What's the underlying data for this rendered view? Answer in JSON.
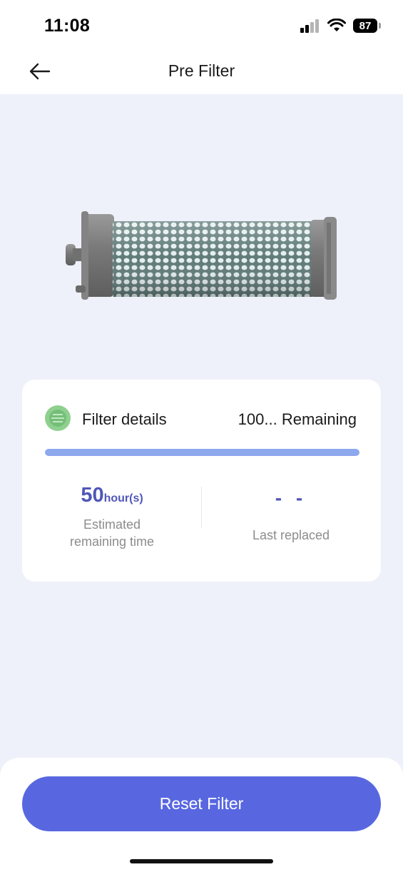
{
  "status": {
    "time": "11:08",
    "battery": "87"
  },
  "nav": {
    "title": "Pre Filter",
    "back_icon": "arrow-left-icon"
  },
  "card": {
    "title": "Filter details",
    "remaining": "100... Remaining",
    "progress_percent": 100,
    "estimated": {
      "value": "50",
      "unit": "hour(s)",
      "label_line1": "Estimated",
      "label_line2": "remaining time"
    },
    "last_replaced": {
      "value": "- -",
      "label": "Last replaced"
    }
  },
  "actions": {
    "reset_label": "Reset Filter"
  },
  "colors": {
    "accent": "#5867e0",
    "value": "#5057b7",
    "progress": "#8ea8ee",
    "background": "#eff1fa"
  }
}
